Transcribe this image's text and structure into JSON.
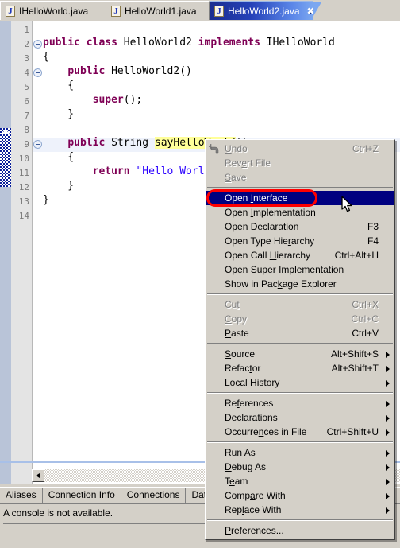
{
  "editor_tabs": [
    {
      "label": "IHelloWorld.java",
      "icon": "java-file-icon",
      "active": false
    },
    {
      "label": "HelloWorld1.java",
      "icon": "java-file-icon",
      "active": false
    },
    {
      "label": "HelloWorld2.java",
      "icon": "java-file-icon",
      "active": true,
      "close_glyph": "✖"
    }
  ],
  "code": {
    "line_numbers": [
      "1",
      "2",
      "3",
      "4",
      "5",
      "6",
      "7",
      "8",
      "9",
      "10",
      "11",
      "12",
      "13",
      "14"
    ],
    "lines": [
      {
        "n": "1",
        "text": ""
      },
      {
        "n": "2",
        "text": "public class HelloWorld2 implements IHelloWorld"
      },
      {
        "n": "3",
        "text": "{"
      },
      {
        "n": "4",
        "text": "    public HelloWorld2()"
      },
      {
        "n": "5",
        "text": "    {"
      },
      {
        "n": "6",
        "text": "        super();"
      },
      {
        "n": "7",
        "text": "    }"
      },
      {
        "n": "8",
        "text": ""
      },
      {
        "n": "9",
        "text": "    public String sayHelloWorld()"
      },
      {
        "n": "10",
        "text": "    {"
      },
      {
        "n": "11",
        "text": "        return \"Hello World"
      },
      {
        "n": "12",
        "text": "    }"
      },
      {
        "n": "13",
        "text": "}"
      },
      {
        "n": "14",
        "text": ""
      }
    ],
    "highlighted_token": "sayHelloWorld",
    "current_line": "9",
    "string_literal": "\"Hello World"
  },
  "context_menu": {
    "items": [
      {
        "label": "Undo",
        "mnemonic": "U",
        "accel": "Ctrl+Z",
        "state": "disabled",
        "icon": "undo-icon"
      },
      {
        "label": "Revert File",
        "mnemonic": "e",
        "accel": "",
        "state": "disabled"
      },
      {
        "label": "Save",
        "mnemonic": "S",
        "accel": "",
        "state": "disabled"
      },
      {
        "separator": true
      },
      {
        "label": "Open Interface",
        "mnemonic": "I",
        "accel": "",
        "state": "selected"
      },
      {
        "label": "Open Implementation",
        "mnemonic": "I",
        "accel": "",
        "state": "normal"
      },
      {
        "label": "Open Declaration",
        "mnemonic": "O",
        "accel": "F3",
        "state": "normal"
      },
      {
        "label": "Open Type Hierarchy",
        "mnemonic": "r",
        "accel": "F4",
        "state": "normal"
      },
      {
        "label": "Open Call Hierarchy",
        "mnemonic": "H",
        "accel": "Ctrl+Alt+H",
        "state": "normal"
      },
      {
        "label": "Open Super Implementation",
        "mnemonic": "u",
        "accel": "",
        "state": "normal"
      },
      {
        "label": "Show in Package Explorer",
        "mnemonic": "k",
        "accel": "",
        "state": "normal"
      },
      {
        "separator": true
      },
      {
        "label": "Cut",
        "mnemonic": "t",
        "accel": "Ctrl+X",
        "state": "disabled"
      },
      {
        "label": "Copy",
        "mnemonic": "C",
        "accel": "Ctrl+C",
        "state": "disabled"
      },
      {
        "label": "Paste",
        "mnemonic": "P",
        "accel": "Ctrl+V",
        "state": "normal"
      },
      {
        "separator": true
      },
      {
        "label": "Source",
        "mnemonic": "S",
        "accel": "Alt+Shift+S",
        "state": "normal",
        "submenu": true
      },
      {
        "label": "Refactor",
        "mnemonic": "t",
        "accel": "Alt+Shift+T",
        "state": "normal",
        "submenu": true
      },
      {
        "label": "Local History",
        "mnemonic": "H",
        "accel": "",
        "state": "normal",
        "submenu": true
      },
      {
        "separator": true
      },
      {
        "label": "References",
        "mnemonic": "f",
        "accel": "",
        "state": "normal",
        "submenu": true
      },
      {
        "label": "Declarations",
        "mnemonic": "l",
        "accel": "",
        "state": "normal",
        "submenu": true
      },
      {
        "label": "Occurrences in File",
        "mnemonic": "n",
        "accel": "Ctrl+Shift+U",
        "state": "normal",
        "submenu": true
      },
      {
        "separator": true
      },
      {
        "label": "Run As",
        "mnemonic": "R",
        "accel": "",
        "state": "normal",
        "submenu": true
      },
      {
        "label": "Debug As",
        "mnemonic": "D",
        "accel": "",
        "state": "normal",
        "submenu": true
      },
      {
        "label": "Team",
        "mnemonic": "e",
        "accel": "",
        "state": "normal",
        "submenu": true
      },
      {
        "label": "Compare With",
        "mnemonic": "a",
        "accel": "",
        "state": "normal",
        "submenu": true
      },
      {
        "label": "Replace With",
        "mnemonic": "l",
        "accel": "",
        "state": "normal",
        "submenu": true
      },
      {
        "separator": true
      },
      {
        "label": "Preferences...",
        "mnemonic": "P",
        "accel": "",
        "state": "normal"
      }
    ]
  },
  "bottom_view": {
    "tabs": [
      {
        "label": "Aliases"
      },
      {
        "label": "Connection Info"
      },
      {
        "label": "Connections"
      },
      {
        "label": "Database St"
      }
    ],
    "console_message": "A console is not available."
  },
  "annotation": {
    "shape": "red-oval",
    "color": "#ff0000",
    "targets": "Open Interface"
  },
  "colors": {
    "keyword": "#7f0055",
    "string": "#2a00ff",
    "highlight": "#ffff99",
    "menu_selection": "#000080",
    "chrome": "#d4d0c8",
    "tab_active_start": "#1b2d8f",
    "tab_active_end": "#7ba7f0",
    "annotation": "#ff0000"
  }
}
